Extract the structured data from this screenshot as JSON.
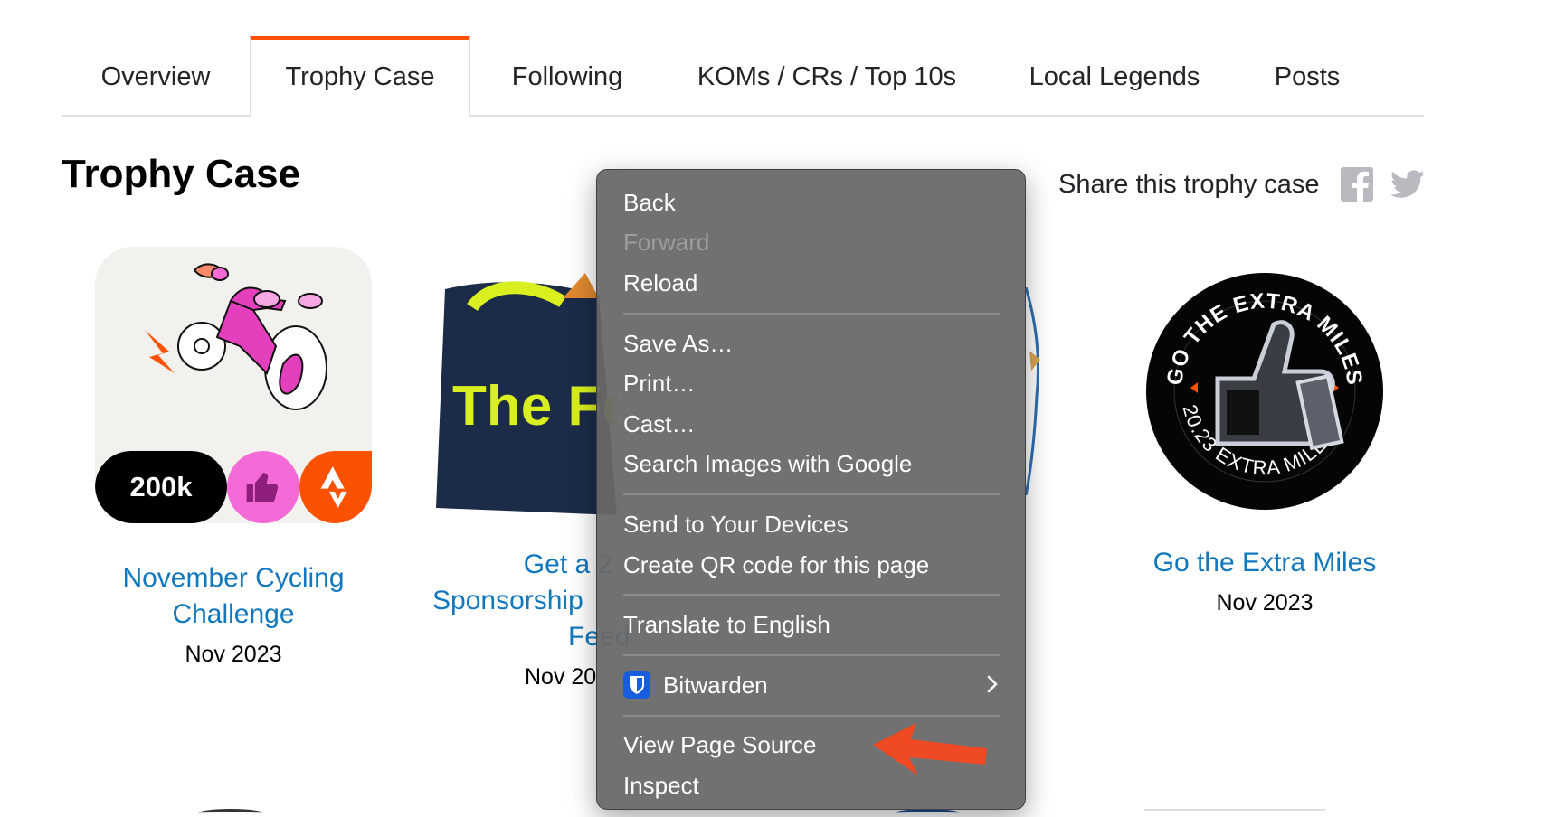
{
  "tabs": [
    {
      "label": "Overview"
    },
    {
      "label": "Trophy Case"
    },
    {
      "label": "Following"
    },
    {
      "label": "KOMs / CRs / Top 10s"
    },
    {
      "label": "Local Legends"
    },
    {
      "label": "Posts"
    }
  ],
  "active_tab": "Trophy Case",
  "page_title": "Trophy Case",
  "share": {
    "label": "Share this trophy case",
    "icons": [
      "facebook-icon",
      "twitter-icon"
    ]
  },
  "trophies": [
    {
      "name_line1": "November Cycling",
      "name_line2": "Challenge",
      "date": "Nov 2023",
      "badge_text": "200k"
    },
    {
      "name_line1": "Get a 2",
      "name_line2": "Sponsorship",
      "name_line3": "Feed",
      "date": "Nov 20",
      "bag_text": "The Fe"
    },
    {
      "name_line1": "Go the Extra Miles",
      "date": "Nov 2023",
      "badge_top": "GO THE EXTRA MILES",
      "badge_bottom": "20.23 EXTRA MILES"
    }
  ],
  "context_menu": {
    "groups": [
      [
        {
          "label": "Back",
          "enabled": true
        },
        {
          "label": "Forward",
          "enabled": false
        },
        {
          "label": "Reload",
          "enabled": true
        }
      ],
      [
        {
          "label": "Save As…",
          "enabled": true
        },
        {
          "label": "Print…",
          "enabled": true
        },
        {
          "label": "Cast…",
          "enabled": true
        },
        {
          "label": "Search Images with Google",
          "enabled": true
        }
      ],
      [
        {
          "label": "Send to Your Devices",
          "enabled": true
        },
        {
          "label": "Create QR code for this page",
          "enabled": true
        }
      ],
      [
        {
          "label": "Translate to English",
          "enabled": true
        }
      ],
      [
        {
          "label": "Bitwarden",
          "enabled": true,
          "icon": "bitwarden-icon",
          "submenu": true
        }
      ],
      [
        {
          "label": "View Page Source",
          "enabled": true
        },
        {
          "label": "Inspect",
          "enabled": true
        }
      ]
    ]
  },
  "colors": {
    "accent": "#fc5200",
    "link": "#1278be",
    "menu_bg": "#686868",
    "arrow": "#f04a24"
  }
}
